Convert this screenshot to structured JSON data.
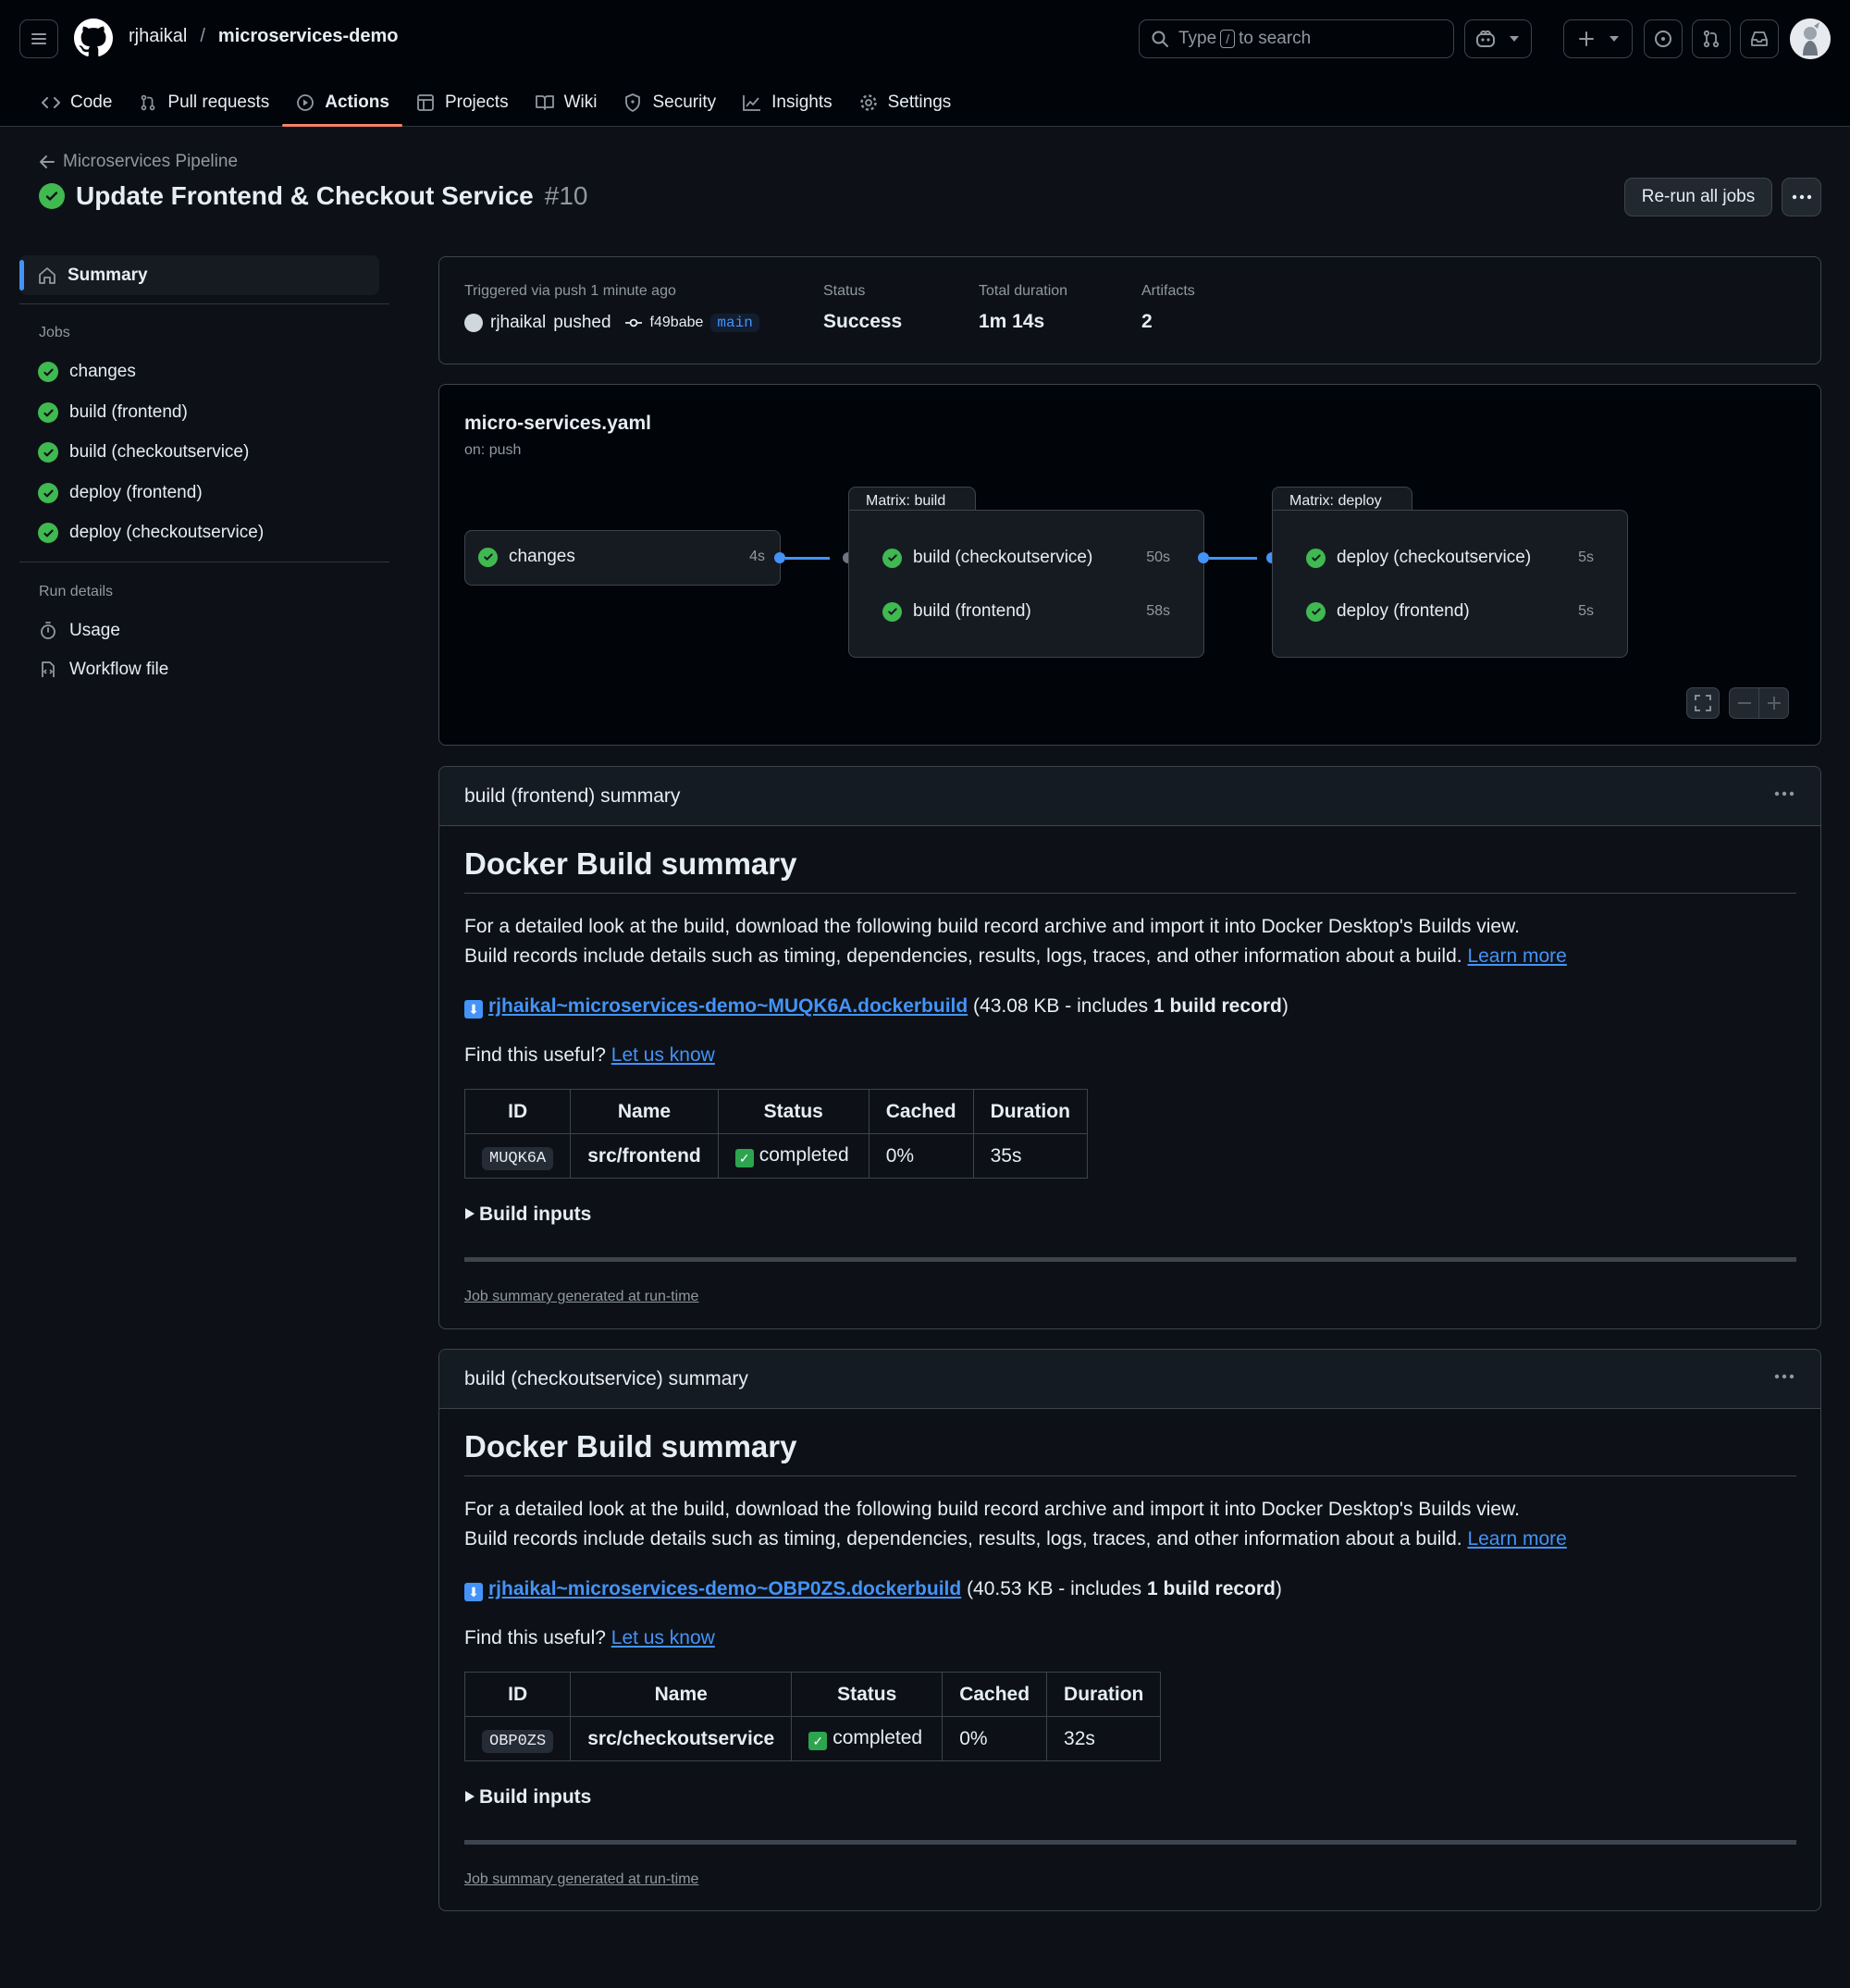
{
  "header": {
    "owner": "rjhaikal",
    "repo": "microservices-demo",
    "search_prefix": "Type",
    "search_key": "/",
    "search_suffix": "to search"
  },
  "tabs": [
    {
      "label": "Code",
      "icon": "code-icon"
    },
    {
      "label": "Pull requests",
      "icon": "git-pull-request-icon"
    },
    {
      "label": "Actions",
      "icon": "play-icon"
    },
    {
      "label": "Projects",
      "icon": "table-icon"
    },
    {
      "label": "Wiki",
      "icon": "book-icon"
    },
    {
      "label": "Security",
      "icon": "shield-icon"
    },
    {
      "label": "Insights",
      "icon": "graph-icon"
    },
    {
      "label": "Settings",
      "icon": "gear-icon"
    }
  ],
  "run": {
    "back_label": "Microservices Pipeline",
    "title": "Update Frontend & Checkout Service",
    "number": "#10",
    "rerun_label": "Re-run all jobs"
  },
  "sidebar": {
    "summary_label": "Summary",
    "jobs_heading": "Jobs",
    "jobs": [
      "changes",
      "build (frontend)",
      "build (checkoutservice)",
      "deploy (frontend)",
      "deploy (checkoutservice)"
    ],
    "details_heading": "Run details",
    "usage_label": "Usage",
    "workflow_label": "Workflow file"
  },
  "meta": {
    "triggered": "Triggered via push 1 minute ago",
    "actor": "rjhaikal",
    "pushed": "pushed",
    "commit": "f49babe",
    "branch": "main",
    "status_label": "Status",
    "status_value": "Success",
    "duration_label": "Total duration",
    "duration_value": "1m 14s",
    "artifacts_label": "Artifacts",
    "artifacts_value": "2"
  },
  "graph": {
    "file": "micro-services.yaml",
    "trigger": "on: push",
    "changes": {
      "name": "changes",
      "time": "4s"
    },
    "build_tab": "Matrix: build",
    "build_jobs": [
      {
        "name": "build (checkoutservice)",
        "time": "50s"
      },
      {
        "name": "build (frontend)",
        "time": "58s"
      }
    ],
    "deploy_tab": "Matrix: deploy",
    "deploy_jobs": [
      {
        "name": "deploy (checkoutservice)",
        "time": "5s"
      },
      {
        "name": "deploy (frontend)",
        "time": "5s"
      }
    ]
  },
  "summaries": [
    {
      "header": "build (frontend) summary",
      "heading": "Docker Build summary",
      "line1": "For a detailed look at the build, download the following build record archive and import it into Docker Desktop's Builds view.",
      "line2": "Build records include details such as timing, dependencies, results, logs, traces, and other information about a build.",
      "learn_more": "Learn more",
      "file_link": "rjhaikal~microservices-demo~MUQK6A.dockerbuild",
      "file_info_pre": "(43.08 KB - includes",
      "file_info_bold": "1 build record",
      "file_info_post": ")",
      "useful": "Find this useful?",
      "let_us_know": "Let us know",
      "columns": [
        "ID",
        "Name",
        "Status",
        "Cached",
        "Duration"
      ],
      "row": {
        "id": "MUQK6A",
        "name": "src/frontend",
        "status": "completed",
        "cached": "0%",
        "duration": "35s"
      },
      "build_inputs": "Build inputs",
      "footer": "Job summary generated at run-time"
    },
    {
      "header": "build (checkoutservice) summary",
      "heading": "Docker Build summary",
      "line1": "For a detailed look at the build, download the following build record archive and import it into Docker Desktop's Builds view.",
      "line2": "Build records include details such as timing, dependencies, results, logs, traces, and other information about a build.",
      "learn_more": "Learn more",
      "file_link": "rjhaikal~microservices-demo~OBP0ZS.dockerbuild",
      "file_info_pre": "(40.53 KB - includes",
      "file_info_bold": "1 build record",
      "file_info_post": ")",
      "useful": "Find this useful?",
      "let_us_know": "Let us know",
      "columns": [
        "ID",
        "Name",
        "Status",
        "Cached",
        "Duration"
      ],
      "row": {
        "id": "OBP0ZS",
        "name": "src/checkoutservice",
        "status": "completed",
        "cached": "0%",
        "duration": "32s"
      },
      "build_inputs": "Build inputs",
      "footer": "Job summary generated at run-time"
    }
  ]
}
